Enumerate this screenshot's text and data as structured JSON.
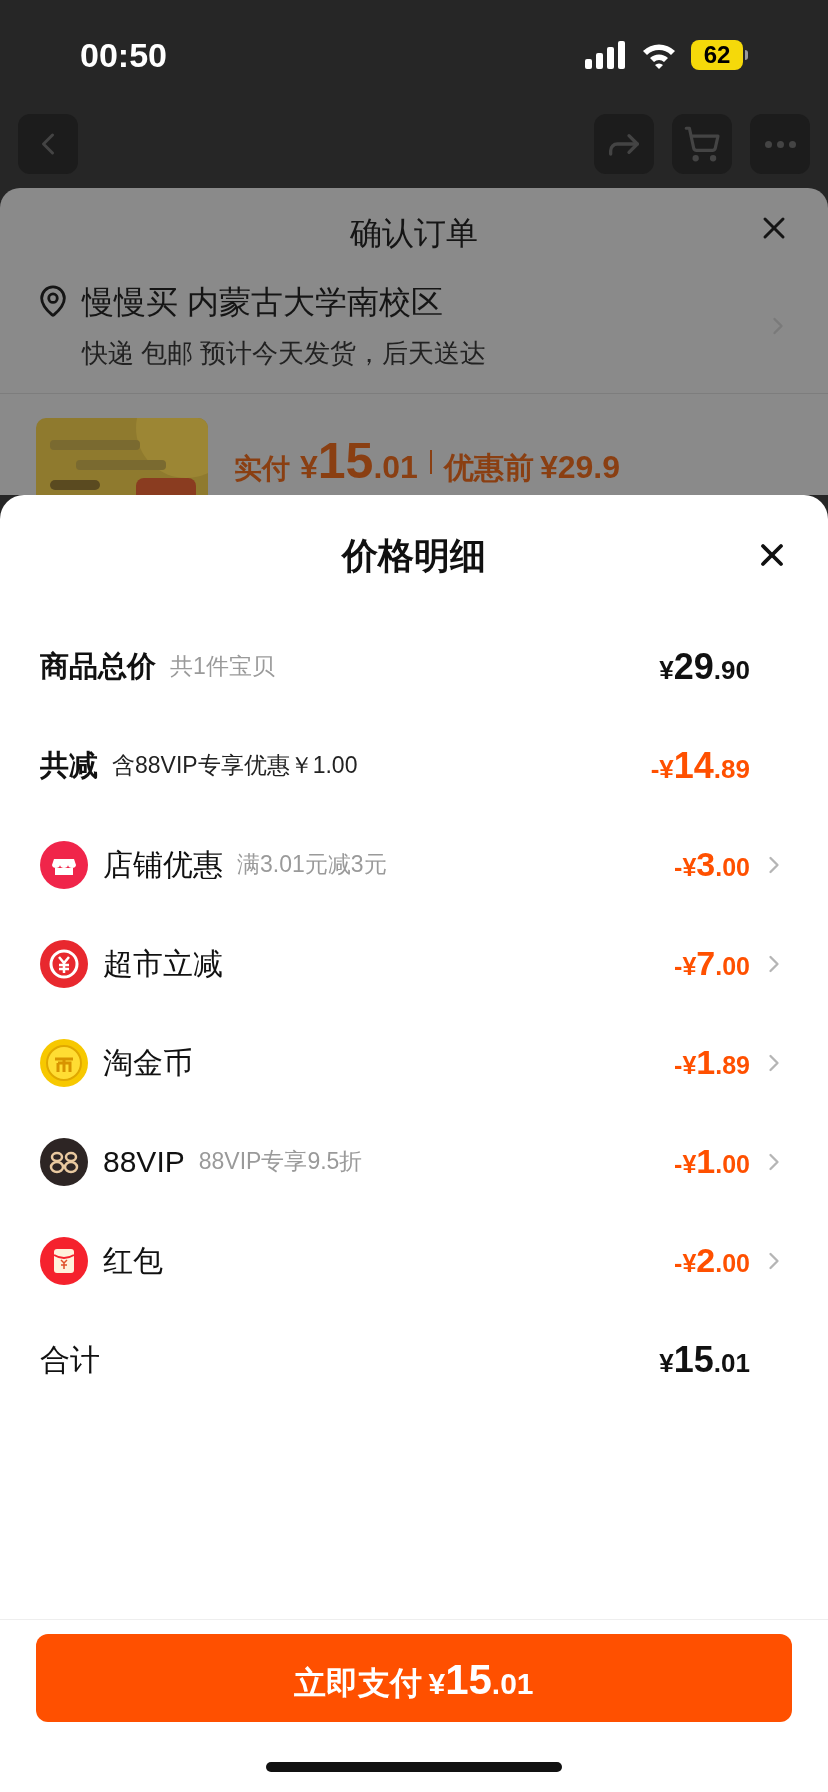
{
  "status_bar": {
    "time": "00:50",
    "battery": "62"
  },
  "order_sheet": {
    "title": "确认订单",
    "address": {
      "name": "慢慢买 内蒙古大学南校区",
      "detail": "快递 包邮 预计今天发货，后天送达"
    },
    "product": {
      "paid_label": "实付",
      "paid_amount": {
        "sign": "¥",
        "main": "15",
        "fraction": ".01"
      },
      "original_label": "优惠前",
      "original_price": "¥29.9"
    }
  },
  "price_detail": {
    "title": "价格明细",
    "rows": [
      {
        "kind": "goods",
        "label": "商品总价",
        "note": "共1件宝贝",
        "amount": {
          "sign": "¥",
          "main": "29",
          "fraction": ".90"
        }
      },
      {
        "kind": "reduction",
        "label": "共减",
        "note": "含88VIP专享优惠￥1.00",
        "amount": {
          "sign": "-¥",
          "main": "14",
          "fraction": ".89"
        }
      },
      {
        "kind": "item",
        "label": "店铺优惠",
        "note": "满3.01元减3元",
        "amount": {
          "sign": "-¥",
          "main": "3",
          "fraction": ".00"
        }
      },
      {
        "kind": "item",
        "label": "超市立减",
        "amount": {
          "sign": "-¥",
          "main": "7",
          "fraction": ".00"
        }
      },
      {
        "kind": "item",
        "label": "淘金币",
        "amount": {
          "sign": "-¥",
          "main": "1",
          "fraction": ".89"
        }
      },
      {
        "kind": "item",
        "label": "88VIP",
        "note": "88VIP专享9.5折",
        "amount": {
          "sign": "-¥",
          "main": "1",
          "fraction": ".00"
        }
      },
      {
        "kind": "item",
        "label": "红包",
        "amount": {
          "sign": "-¥",
          "main": "2",
          "fraction": ".00"
        }
      },
      {
        "kind": "sum",
        "label": "合计",
        "amount": {
          "sign": "¥",
          "main": "15",
          "fraction": ".01"
        }
      }
    ]
  },
  "pay_button": {
    "label": "立即支付",
    "amount": {
      "sign": "¥",
      "main": "15",
      "fraction": ".01"
    }
  }
}
